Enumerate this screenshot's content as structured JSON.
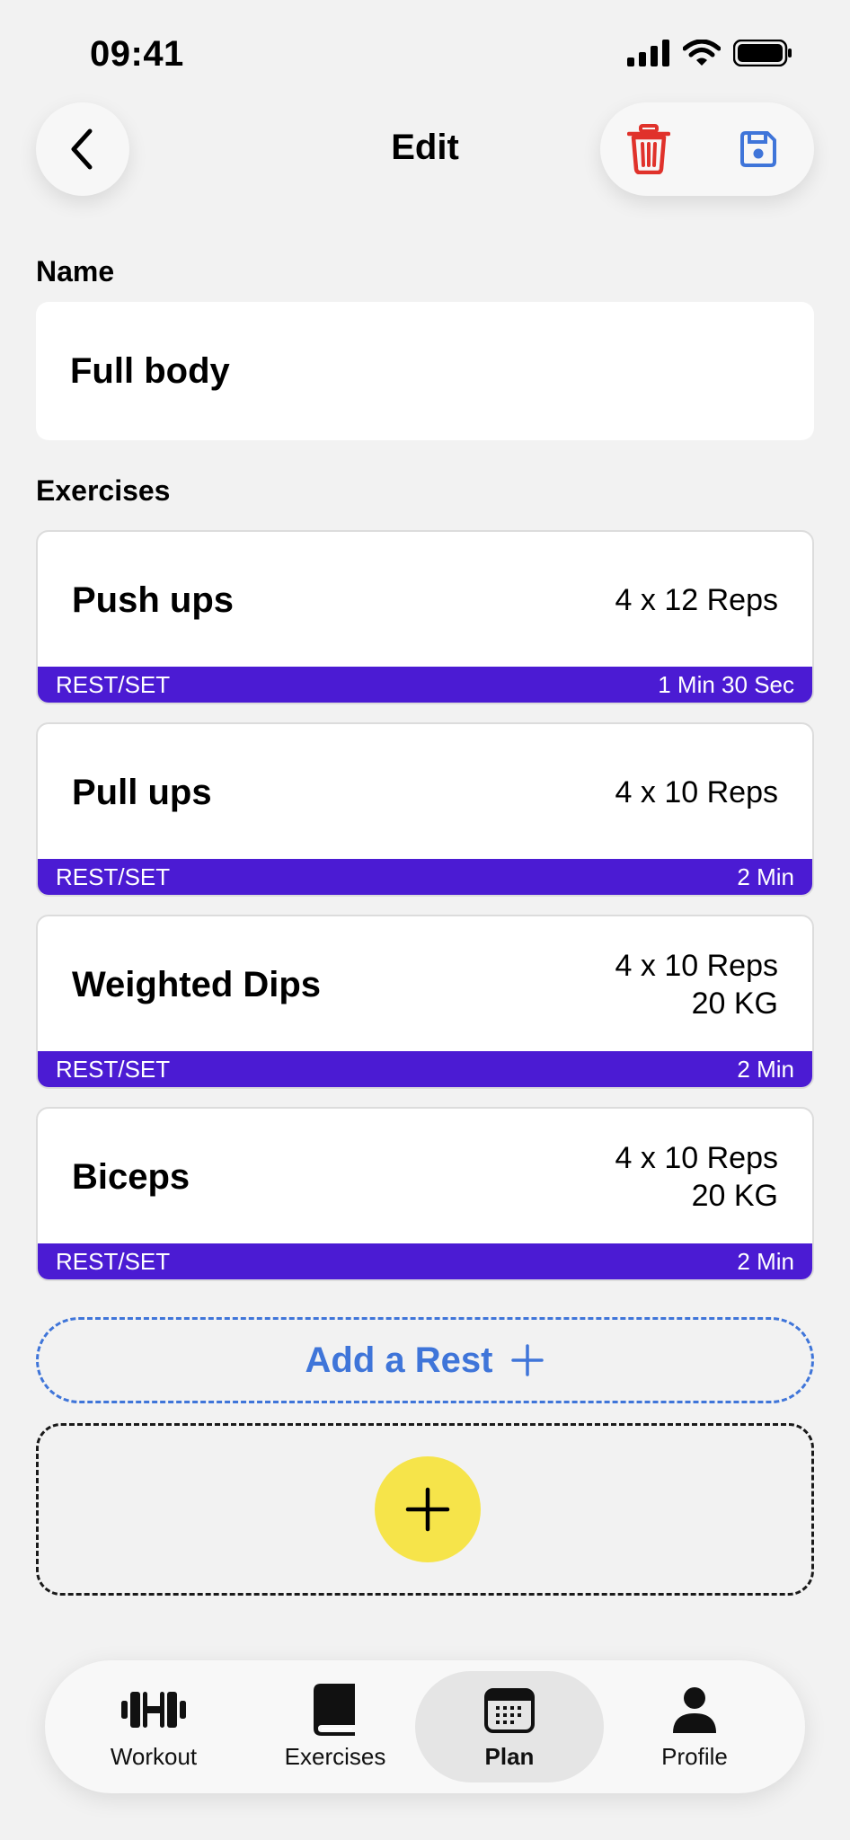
{
  "status_bar": {
    "time": "09:41"
  },
  "header": {
    "title": "Edit"
  },
  "name_section": {
    "label": "Name",
    "value": "Full body"
  },
  "exercises_section": {
    "label": "Exercises",
    "items": [
      {
        "name": "Push ups",
        "detail_line1": "4 x 12 Reps",
        "detail_line2": "",
        "rest_label": "REST/SET",
        "rest_value": "1 Min 30 Sec"
      },
      {
        "name": "Pull ups",
        "detail_line1": "4 x 10 Reps",
        "detail_line2": "",
        "rest_label": "REST/SET",
        "rest_value": "2 Min"
      },
      {
        "name": "Weighted Dips",
        "detail_line1": "4 x 10 Reps",
        "detail_line2": "20 KG",
        "rest_label": "REST/SET",
        "rest_value": "2 Min"
      },
      {
        "name": "Biceps",
        "detail_line1": "4 x 10 Reps",
        "detail_line2": "20 KG",
        "rest_label": "REST/SET",
        "rest_value": "2 Min"
      }
    ]
  },
  "add_rest": {
    "label": "Add a Rest"
  },
  "tabbar": {
    "tabs": [
      {
        "label": "Workout",
        "icon": "dumbbell-icon"
      },
      {
        "label": "Exercises",
        "icon": "book-icon"
      },
      {
        "label": "Plan",
        "icon": "calendar-icon",
        "active": true
      },
      {
        "label": "Profile",
        "icon": "person-icon"
      }
    ]
  },
  "colors": {
    "accent": "#4b1bd3",
    "link": "#3f75d9",
    "delete": "#e0322b",
    "fab": "#f6e44a",
    "background": "#f2f2f2"
  }
}
